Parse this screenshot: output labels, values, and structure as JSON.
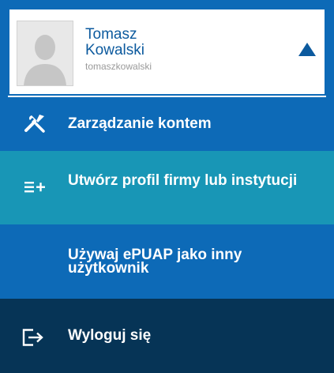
{
  "user": {
    "first_name": "Tomasz",
    "last_name": "Kowalski",
    "login": "tomaszkowalski",
    "toggle_icon": "caret-up-icon",
    "avatar_icon": "person-silhouette-icon"
  },
  "menu": {
    "items": [
      {
        "label": "Zarządzanie kontem",
        "icon": "tools-icon"
      },
      {
        "label": "Utwórz profil firmy lub instytucji",
        "icon": "list-add-icon"
      },
      {
        "label": "Używaj ePUAP jako inny użytkownik",
        "icon": ""
      },
      {
        "label": "Wyloguj się",
        "icon": "logout-icon"
      }
    ]
  },
  "colors": {
    "primary": "#0d6ab7",
    "teal": "#1896b6",
    "dark": "#063456",
    "name_text": "#0c5a9e",
    "login_text": "#9a9a9a"
  }
}
